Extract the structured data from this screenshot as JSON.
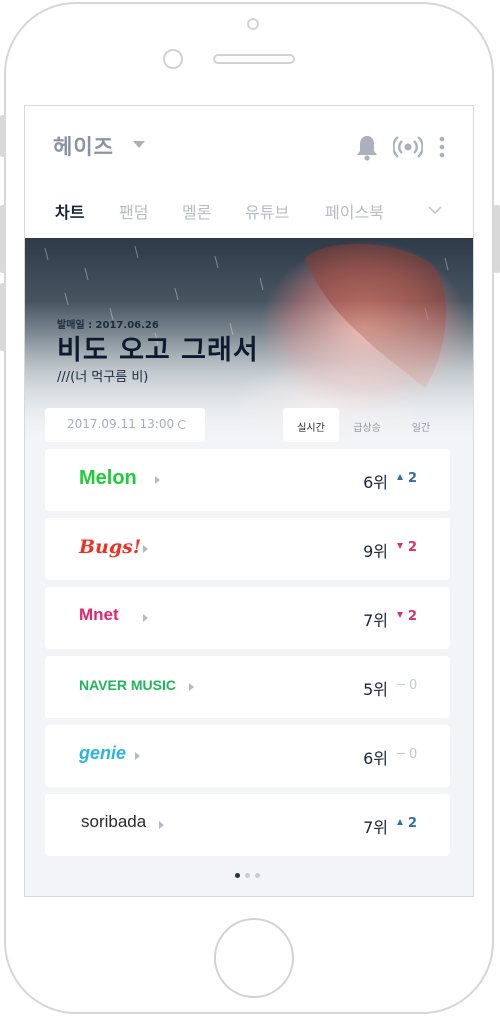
{
  "header": {
    "artist": "헤이즈"
  },
  "tabs": [
    {
      "label": "차트",
      "active": true
    },
    {
      "label": "팬덤",
      "active": false
    },
    {
      "label": "멜론",
      "active": false
    },
    {
      "label": "유튜브",
      "active": false
    },
    {
      "label": "페이스북",
      "active": false
    }
  ],
  "song": {
    "release": "발매일 : 2017.06.26",
    "title": "비도 오고 그래서",
    "subtitle": "///(너 먹구름 비)"
  },
  "chart_controls": {
    "timestamp": "2017.09.11 13:00",
    "modes": [
      "실시간",
      "급상승",
      "일간"
    ],
    "active_mode": "실시간"
  },
  "charts": [
    {
      "service": "Melon",
      "rank": "6위",
      "direction": "up",
      "change": "2",
      "color": "#1fcb3a"
    },
    {
      "service": "Bugs!",
      "rank": "9위",
      "direction": "down",
      "change": "2",
      "color": "#ee3124"
    },
    {
      "service": "Mnet",
      "rank": "7위",
      "direction": "down",
      "change": "2",
      "color": "#e6246b"
    },
    {
      "service": "NAVER MUSIC",
      "rank": "5위",
      "direction": "none",
      "change": "0",
      "color": "#1fb55b"
    },
    {
      "service": "genie",
      "rank": "6위",
      "direction": "none",
      "change": "0",
      "color": "#2bb3e6"
    },
    {
      "service": "soribada",
      "rank": "7위",
      "direction": "up",
      "change": "2",
      "color": "#2a2a2a"
    }
  ],
  "pager": {
    "pages": 3,
    "current": 1
  },
  "colors": {
    "up": "#2f6fb1",
    "down": "#d8336c",
    "neutral": "#c4c9d1"
  }
}
